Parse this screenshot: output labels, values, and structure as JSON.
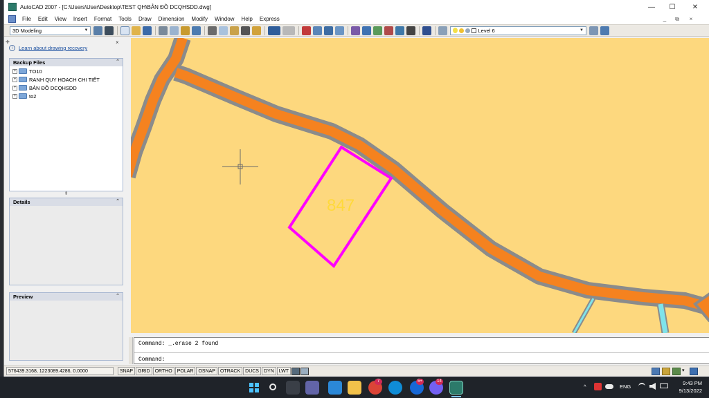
{
  "window": {
    "title": "AutoCAD 2007 - [C:\\Users\\User\\Desktop\\TEST QH\\BẢN ĐỒ DCQHSDD.dwg]",
    "minimize": "—",
    "maximize": "☐",
    "close": "✕"
  },
  "menu": {
    "items": [
      "File",
      "Edit",
      "View",
      "Insert",
      "Format",
      "Tools",
      "Draw",
      "Dimension",
      "Modify",
      "Window",
      "Help",
      "Express"
    ],
    "doc_minimize": "_",
    "doc_restore": "⧉",
    "doc_close": "×"
  },
  "toolbar": {
    "workspace": "3D Modeling",
    "layer": "Level 6"
  },
  "sidebar": {
    "close": "×",
    "recovery_link": "Learn about drawing recovery",
    "backup_title": "Backup Files",
    "backup_items": [
      "TO10",
      "RANH QUY HOACH CHI TIẾT",
      "BẢN ĐỒ DCQHSDD",
      "to2"
    ],
    "details_title": "Details",
    "preview_title": "Preview",
    "collapse_glyph": "⌃"
  },
  "drawing": {
    "parcel_label": "847",
    "colors": {
      "background": "#fdd87e",
      "road_fill": "#f5821f",
      "road_edge": "#8b8b8b",
      "parcel_outline": "#ff00ff",
      "parcel_label": "#ffd93b",
      "water": "#7fe3ea"
    }
  },
  "command": {
    "history": "Command: _.erase 2 found",
    "prompt": "Command:"
  },
  "status": {
    "coordinates": "576439.3168, 1223089.4286, 0.0000",
    "toggles": [
      "SNAP",
      "GRID",
      "ORTHO",
      "POLAR",
      "OSNAP",
      "OTRACK",
      "DUCS",
      "DYN",
      "LWT"
    ]
  },
  "taskbar": {
    "badges": {
      "chrome": "7",
      "zalo": "5+",
      "viber": "14"
    },
    "language": "ENG",
    "time": "9:43 PM",
    "date": "9/13/2022"
  }
}
